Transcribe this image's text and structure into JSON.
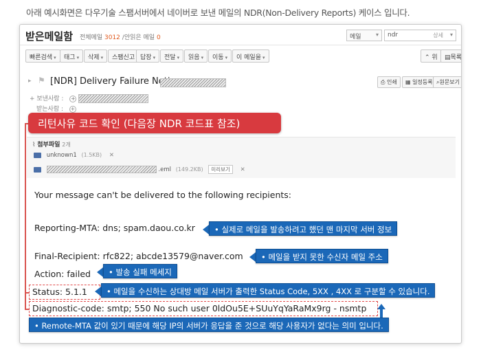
{
  "caption": "아래 예시화면은 다우기술 스팸서버에서 네이버로 보낸 메일의 NDR(Non-Delivery Reports) 케이스 입니다.",
  "mail": {
    "mailbox_title": "받은메일함",
    "total_label": "전체메일",
    "total_count": "3012",
    "unread_label": "/안읽은 메일",
    "unread_count": "0",
    "search_scope": "메일",
    "search_query": "ndr",
    "search_detail": "상세"
  },
  "toolbar": {
    "quick_search": "빠른검색",
    "tag": "태그",
    "delete": "삭제",
    "spam_block": "스팸신고",
    "reply": "답장",
    "forward": "전달",
    "read": "읽음",
    "move": "이동",
    "this_mail": "이 메일을",
    "up": "위",
    "list": "목록"
  },
  "message": {
    "subject": "[NDR] Delivery Failure Notice :",
    "print": "인쇄",
    "schedule": "일정등록",
    "source": "원문보기",
    "sender_label": "보낸사람 :",
    "recipient_label": "받는사람 :",
    "attachments_label": "첨부파일",
    "attachments_count": "2개",
    "attachments": [
      {
        "name": "unknown1",
        "size": "(1.5KB)"
      },
      {
        "name": ".eml",
        "size": "(149.2KB)",
        "preview": "미리보기"
      }
    ]
  },
  "body": {
    "line1": "Your message can't be delivered to the following recipients:",
    "reporting_mta": "Reporting-MTA: dns; spam.daou.co.kr",
    "final_recipient": "Final-Recipient: rfc822; abcde13579@naver.com",
    "action": "Action: failed",
    "status": "Status: 5.1.1",
    "diagnostic": "Diagnostic-code: smtp; 550 No such user 0ldOu5E+SUuYqYaRaMx9rg - nsmtp"
  },
  "annotations": {
    "red_callout": "리턴사유 코드 확인 (다음장 NDR 코드표 참조)",
    "reporting_mta": "• 실제로 메일을 발송하려고 했던 맨 마지막 서버 정보",
    "final_recipient": "• 메일을 받지 못한 수신자 메일 주소",
    "action": "• 발송 실패 메세지",
    "status": "• 메일을 수신하는 상대방 메일 서버가 출력한 Status Code, 5XX , 4XX 로 구분할 수 있습니다.",
    "diagnostic": "• Remote-MTA 값이 있기 때문에 해당 IP의 서버가 응답을 준 것으로 해당 사용자가 없다는 의미 입니다."
  },
  "colors": {
    "callout_blue": "#1b68b8",
    "callout_red": "#d83a3f",
    "count_orange": "#e05a1e"
  }
}
